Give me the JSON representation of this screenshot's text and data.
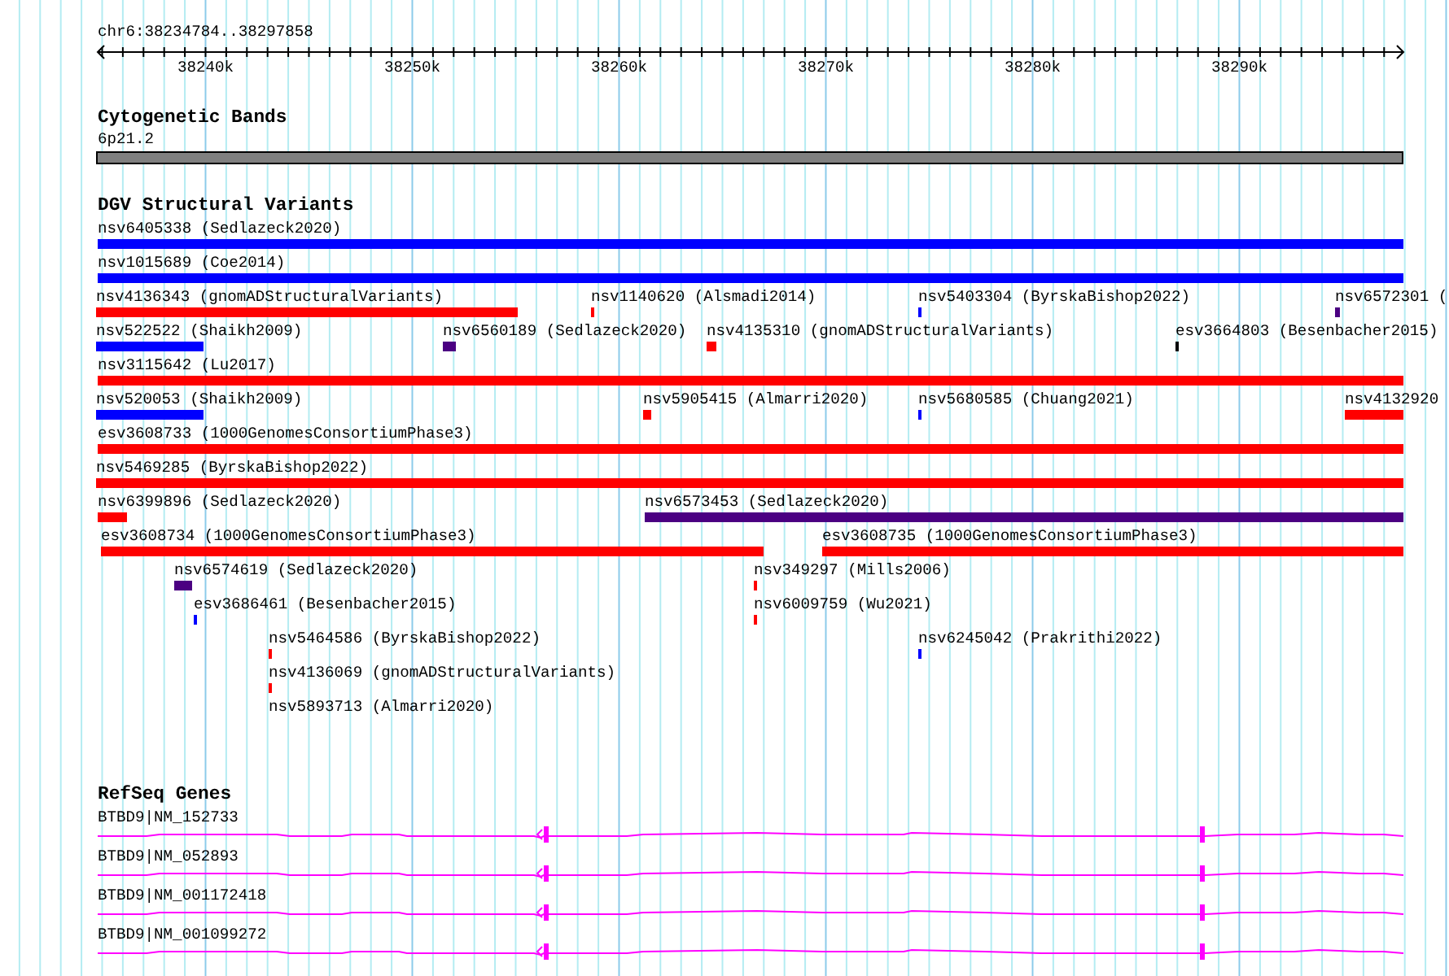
{
  "ruler": {
    "location": "chr6:38234784..38297858",
    "ticks": [
      "38240k",
      "38250k",
      "38260k",
      "38270k",
      "38280k",
      "38290k"
    ]
  },
  "tracks": [
    {
      "kind": "bands",
      "title": "Cytogenetic Bands",
      "band": {
        "label": "6p21.2"
      }
    },
    {
      "kind": "variants",
      "title": "DGV Structural Variants",
      "rows": [
        {
          "features": [
            {
              "label": "nsv6405338 (Sedlazeck2020)",
              "color": "#0000ff"
            }
          ]
        },
        {
          "features": [
            {
              "label": "nsv1015689 (Coe2014)",
              "color": "#0000ff"
            }
          ]
        },
        {
          "features": [
            {
              "label": "nsv4136343 (gnomADStructuralVariants)",
              "color": "#ff0000"
            },
            {
              "label": "nsv1140620 (Alsmadi2014)",
              "color": "#ff0000"
            },
            {
              "label": "nsv5403304 (ByrskaBishop2022)",
              "color": "#0000ff"
            },
            {
              "label": "nsv6572301 (",
              "color": "#4b0082"
            }
          ]
        },
        {
          "features": [
            {
              "label": "nsv522522 (Shaikh2009)",
              "color": "#0000ff"
            },
            {
              "label": "nsv6560189 (Sedlazeck2020)",
              "color": "#4b0082"
            },
            {
              "label": "nsv4135310 (gnomADStructuralVariants)",
              "color": "#ff0000"
            },
            {
              "label": "esv3664803 (Besenbacher2015)",
              "color": "#000000"
            }
          ]
        },
        {
          "features": [
            {
              "label": "nsv3115642 (Lu2017)",
              "color": "#ff0000"
            }
          ]
        },
        {
          "features": [
            {
              "label": "nsv520053 (Shaikh2009)",
              "color": "#0000ff"
            },
            {
              "label": "nsv5905415 (Almarri2020)",
              "color": "#ff0000"
            },
            {
              "label": "nsv5680585 (Chuang2021)",
              "color": "#0000ff"
            },
            {
              "label": "nsv4132920",
              "color": "#ff0000"
            }
          ]
        },
        {
          "features": [
            {
              "label": "esv3608733 (1000GenomesConsortiumPhase3)",
              "color": "#ff0000"
            }
          ]
        },
        {
          "features": [
            {
              "label": "nsv5469285 (ByrskaBishop2022)",
              "color": "#ff0000"
            }
          ]
        },
        {
          "features": [
            {
              "label": "nsv6399896 (Sedlazeck2020)",
              "color": "#ff0000"
            },
            {
              "label": "nsv6573453 (Sedlazeck2020)",
              "color": "#4b0082"
            }
          ]
        },
        {
          "features": [
            {
              "label": "esv3608734 (1000GenomesConsortiumPhase3)",
              "color": "#ff0000"
            },
            {
              "label": "esv3608735 (1000GenomesConsortiumPhase3)",
              "color": "#ff0000"
            }
          ]
        },
        {
          "features": [
            {
              "label": "nsv6574619 (Sedlazeck2020)",
              "color": "#4b0082"
            },
            {
              "label": "nsv349297 (Mills2006)",
              "color": "#ff0000"
            }
          ]
        },
        {
          "features": [
            {
              "label": "esv3686461 (Besenbacher2015)",
              "color": "#0000ff"
            },
            {
              "label": "nsv6009759 (Wu2021)",
              "color": "#ff0000"
            }
          ]
        },
        {
          "features": [
            {
              "label": "nsv5464586 (ByrskaBishop2022)",
              "color": "#ff0000"
            },
            {
              "label": "nsv6245042 (Prakrithi2022)",
              "color": "#0000ff"
            }
          ]
        },
        {
          "features": [
            {
              "label": "nsv4136069 (gnomADStructuralVariants)",
              "color": "#ff0000"
            }
          ]
        },
        {
          "features": [
            {
              "label": "nsv5893713 (Almarri2020)"
            }
          ]
        }
      ]
    },
    {
      "kind": "genes",
      "title": "RefSeq Genes",
      "transcripts": [
        {
          "label": "BTBD9|NM_152733"
        },
        {
          "label": "BTBD9|NM_052893"
        },
        {
          "label": "BTBD9|NM_001172418"
        },
        {
          "label": "BTBD9|NM_001099272"
        }
      ]
    }
  ]
}
